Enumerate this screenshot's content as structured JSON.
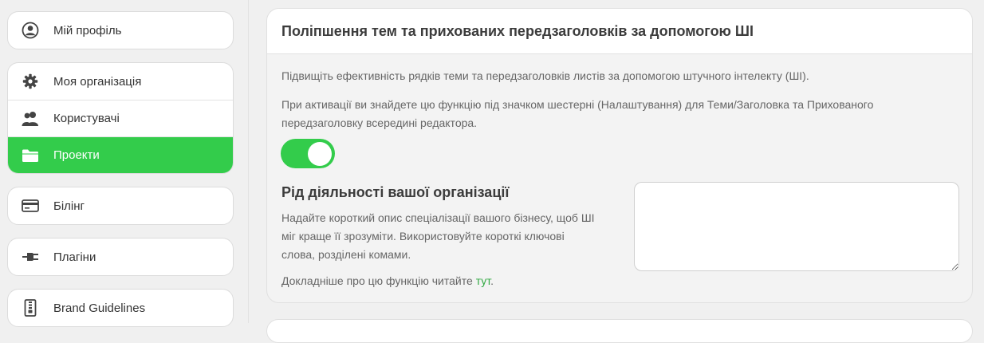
{
  "sidebar": {
    "profile": {
      "label": "Мій профіль",
      "icon": "user-circle-icon"
    },
    "org_group": [
      {
        "label": "Моя організація",
        "icon": "gear-icon"
      },
      {
        "label": "Користувачі",
        "icon": "users-icon"
      },
      {
        "label": "Проекти",
        "icon": "folder-icon",
        "active": true
      }
    ],
    "billing": {
      "label": "Білінг",
      "icon": "credit-card-icon"
    },
    "plugins": {
      "label": "Плагіни",
      "icon": "plug-icon"
    },
    "brand": {
      "label": "Brand Guidelines",
      "icon": "zipper-file-icon"
    }
  },
  "card": {
    "title": "Поліпшення тем та прихованих передзаголовків за допомогою ШІ",
    "description": "Підвищіть ефективність рядків теми та передзаголовків листів за допомогою штучного інтелекту (ШІ).",
    "activation_note": "При активації ви знайдете цю функцію під значком шестерні (Налаштування) для Теми/Заголовка та Прихованого передзаголовку всередині редактора.",
    "toggle_on": true,
    "business": {
      "title": "Рід діяльності вашої організації",
      "description": "Надайте короткий опис спеціалізації вашого бізнесу, щоб ШІ міг краще її зрозуміти. Використовуйте короткі ключові слова, розділені комами.",
      "textarea_value": ""
    },
    "more_prefix": "Докладніше про цю функцію читайте ",
    "more_link": "тут",
    "more_suffix": "."
  },
  "colors": {
    "accent": "#33cc4b",
    "link": "#33aa44"
  }
}
